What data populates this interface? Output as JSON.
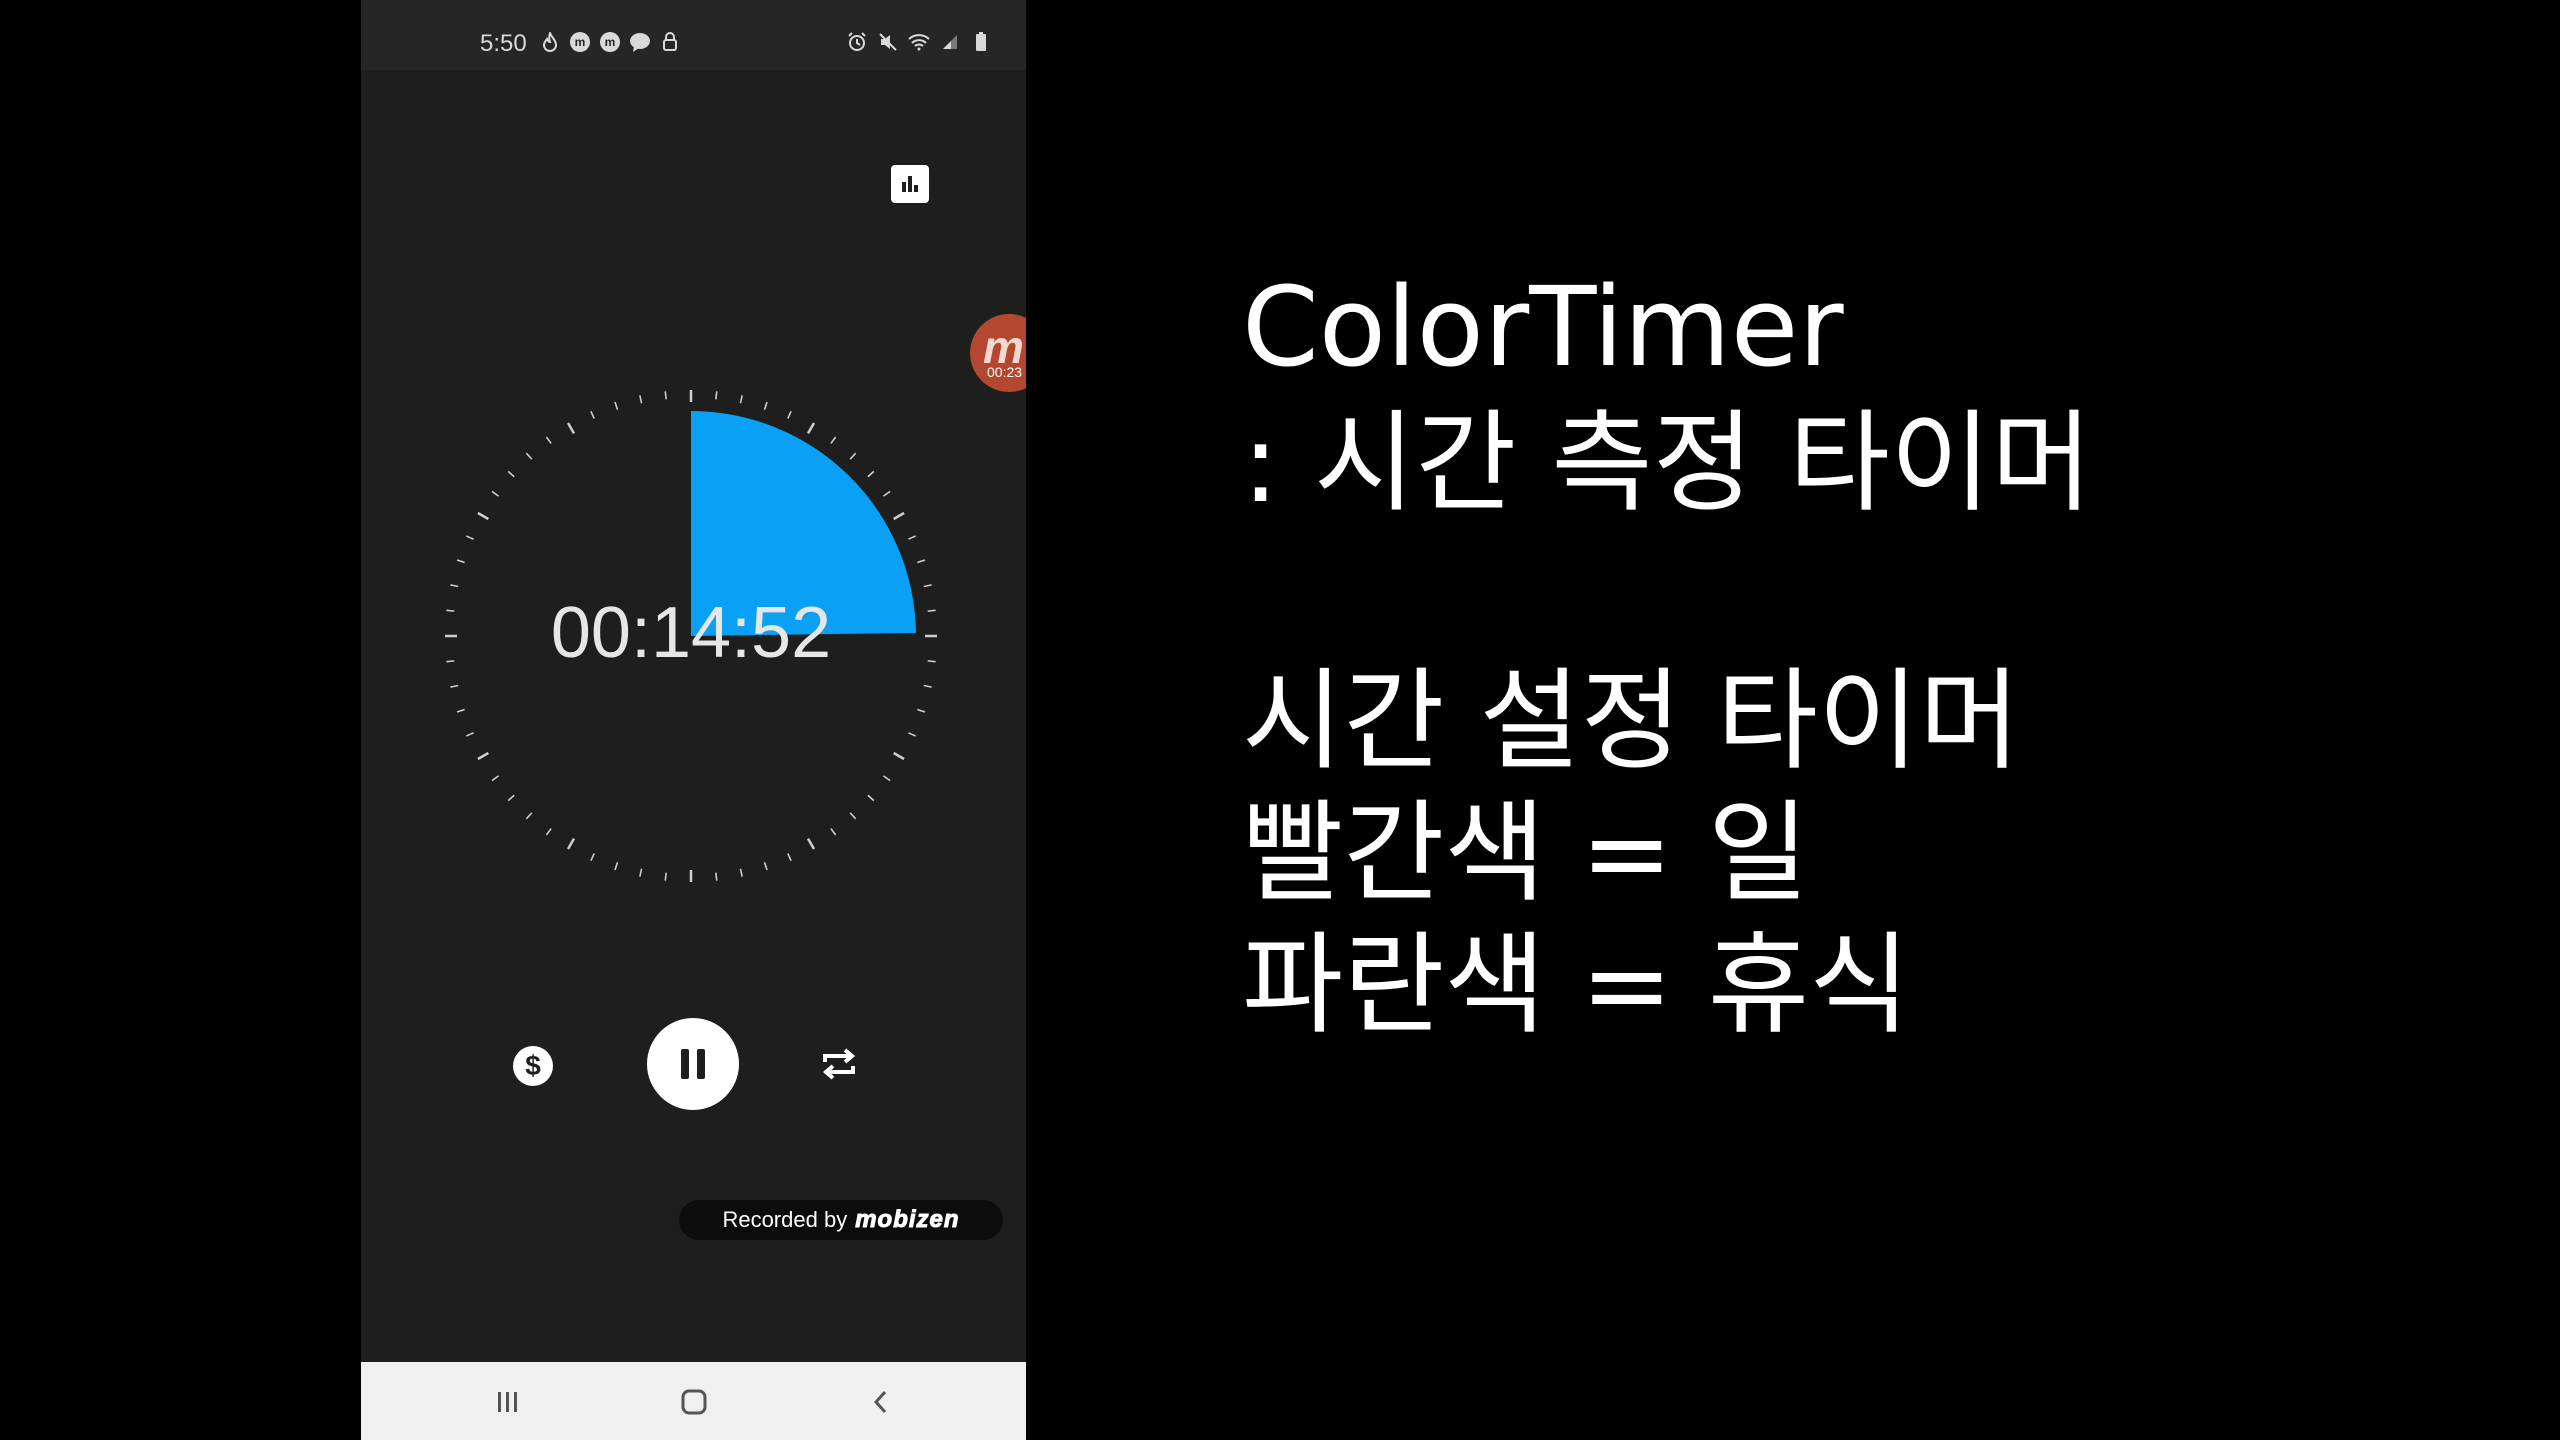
{
  "status_bar": {
    "time": "5:50",
    "left_icons": [
      "flame-icon",
      "m-badge-icon",
      "m-badge-icon",
      "chat-bubble-icon",
      "lock-icon"
    ],
    "right_icons": [
      "alarm-icon",
      "mute-icon",
      "wifi-icon",
      "signal-icon",
      "battery-icon"
    ]
  },
  "timer": {
    "display": "00:14:52",
    "remaining_fraction": 0.2478,
    "color": "#0aa0f5"
  },
  "overlay": {
    "mobizen_letter": "m",
    "mobizen_time": "00:23"
  },
  "controls": [
    {
      "name": "dollar-button",
      "icon": "dollar-icon"
    },
    {
      "name": "pause-button",
      "icon": "pause-icon"
    },
    {
      "name": "repeat-button",
      "icon": "repeat-icon"
    }
  ],
  "recorded_badge": {
    "label": "Recorded by",
    "logo": "mobizen"
  },
  "nav_bar": [
    "recent-apps-icon",
    "home-icon",
    "back-icon"
  ],
  "caption": {
    "line1": "ColorTimer",
    "line2": ": 시간 측정 타이머",
    "line3": "시간 설정 타이머",
    "line4": "빨간색 = 일",
    "line5": "파란색 = 휴식"
  },
  "colors": {
    "phone_background": "#1e1e1e",
    "accent_blue": "#0aa0f5",
    "page_background": "#000000"
  }
}
